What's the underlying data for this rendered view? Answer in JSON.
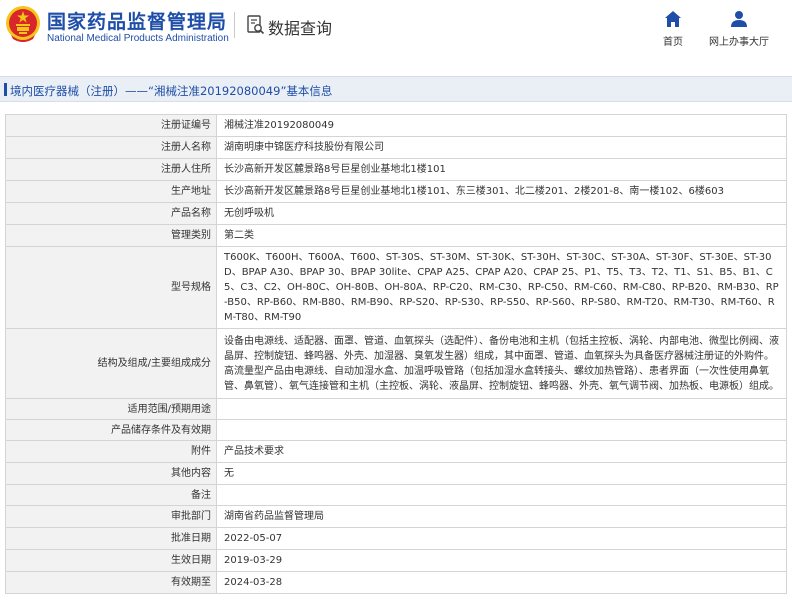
{
  "header": {
    "site_name_cn": "国家药品监督管理局",
    "site_name_en": "National Medical Products Administration",
    "section_title": "数据查询",
    "nav": [
      {
        "label": "首页",
        "icon": "home-icon"
      },
      {
        "label": "网上办事大厅",
        "icon": "user-icon"
      }
    ]
  },
  "breadcrumb": {
    "text": "境内医疗器械（注册）——“湘械注准20192080049”基本信息"
  },
  "colors": {
    "brand_blue": "#1f4ea8",
    "emblem_red": "#d8262b",
    "emblem_gold": "#f5c518",
    "label_bg": "#f2f2f2",
    "border": "#d4d4d4"
  },
  "table": {
    "rows": [
      {
        "label": "注册证编号",
        "value": "湘械注准20192080049"
      },
      {
        "label": "注册人名称",
        "value": "湖南明康中锦医疗科技股份有限公司"
      },
      {
        "label": "注册人住所",
        "value": "长沙高新开发区麓景路8号巨星创业基地北1楼101"
      },
      {
        "label": "生产地址",
        "value": "长沙高新开发区麓景路8号巨星创业基地北1楼101、东三楼301、北二楼201、2楼201-8、南一楼102、6楼603"
      },
      {
        "label": "产品名称",
        "value": "无创呼吸机"
      },
      {
        "label": "管理类别",
        "value": "第二类"
      },
      {
        "label": "型号规格",
        "value": "T600K、T600H、T600A、T600、ST-30S、ST-30M、ST-30K、ST-30H、ST-30C、ST-30A、ST-30F、ST-30E、ST-30D、BPAP A30、BPAP 30、BPAP 30lite、CPAP A25、CPAP A20、CPAP 25、P1、T5、T3、T2、T1、S1、B5、B1、C5、C3、C2、OH-80C、OH-80B、OH-80A、RP-C20、RM-C30、RP-C50、RM-C60、RM-C80、RP-B20、RM-B30、RP-B50、RP-B60、RM-B80、RM-B90、RP-S20、RP-S30、RP-S50、RP-S60、RP-S80、RM-T20、RM-T30、RM-T60、RM-T80、RM-T90"
      },
      {
        "label": "结构及组成/主要组成成分",
        "value": "设备由电源线、适配器、面罩、管道、血氧探头（选配件）、备份电池和主机（包括主控板、涡轮、内部电池、微型比例阀、液晶屏、控制旋钮、蜂鸣器、外壳、加湿器、臭氧发生器）组成，其中面罩、管道、血氧探头为具备医疗器械注册证的外购件。高流量型产品由电源线、自动加湿水盒、加温呼吸管路（包括加湿水盒转接头、螺纹加热管路）、患者界面（一次性使用鼻氧管、鼻氧管）、氧气连接管和主机（主控板、涡轮、液晶屏、控制旋钮、蜂鸣器、外壳、氧气调节阀、加热板、电源板）组成。"
      },
      {
        "label": "适用范围/预期用途",
        "value": ""
      },
      {
        "label": "产品储存条件及有效期",
        "value": ""
      },
      {
        "label": "附件",
        "value": "产品技术要求"
      },
      {
        "label": "其他内容",
        "value": "无"
      },
      {
        "label": "备注",
        "value": ""
      },
      {
        "label": "审批部门",
        "value": "湖南省药品监督管理局"
      },
      {
        "label": "批准日期",
        "value": "2022-05-07"
      },
      {
        "label": "生效日期",
        "value": "2019-03-29"
      },
      {
        "label": "有效期至",
        "value": "2024-03-28"
      }
    ]
  }
}
